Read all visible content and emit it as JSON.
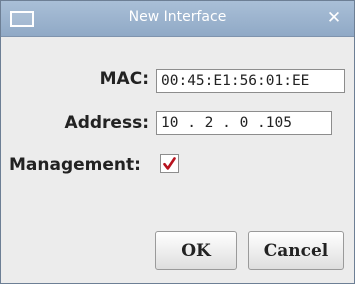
{
  "window": {
    "title": "New Interface",
    "close_glyph": "✕",
    "system_icon": "window-menu-icon"
  },
  "form": {
    "mac_label": "MAC:",
    "mac_value": "00:45:E1:56:01:EE",
    "address_label": "Address:",
    "address_value": "10 . 2 . 0 .105",
    "management_label": "Management:",
    "management_checked": true
  },
  "buttons": {
    "ok_label": "OK",
    "cancel_label": "Cancel"
  },
  "colors": {
    "titlebar": "#9bb3cf",
    "checkmark": "#b8131f",
    "background": "#ececec"
  }
}
